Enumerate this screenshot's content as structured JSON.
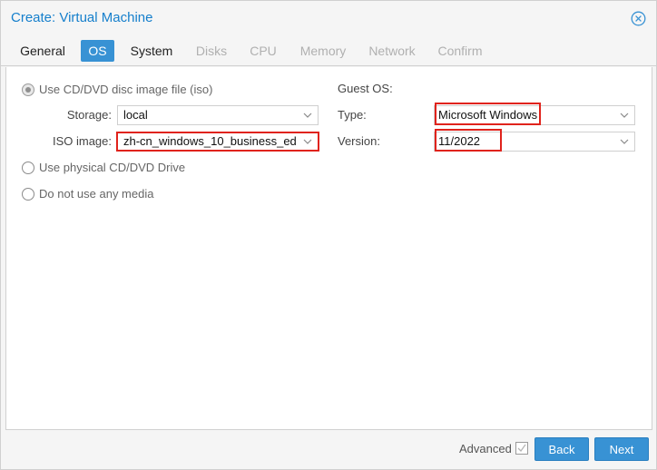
{
  "window": {
    "title": "Create: Virtual Machine",
    "close_icon": "close-circle-icon"
  },
  "tabs": [
    {
      "label": "General",
      "state": "enabled"
    },
    {
      "label": "OS",
      "state": "active"
    },
    {
      "label": "System",
      "state": "enabled"
    },
    {
      "label": "Disks",
      "state": "disabled"
    },
    {
      "label": "CPU",
      "state": "disabled"
    },
    {
      "label": "Memory",
      "state": "disabled"
    },
    {
      "label": "Network",
      "state": "disabled"
    },
    {
      "label": "Confirm",
      "state": "disabled"
    }
  ],
  "media": {
    "option_iso": "Use CD/DVD disc image file (iso)",
    "storage_label": "Storage:",
    "storage_value": "local",
    "iso_label": "ISO image:",
    "iso_value": "zh-cn_windows_10_business_ed",
    "option_physical": "Use physical CD/DVD Drive",
    "option_none": "Do not use any media",
    "selected": "iso"
  },
  "guest_os": {
    "heading": "Guest OS:",
    "type_label": "Type:",
    "type_value": "Microsoft Windows",
    "version_label": "Version:",
    "version_value": "11/2022"
  },
  "footer": {
    "advanced_label": "Advanced",
    "advanced_checked": false,
    "back_label": "Back",
    "next_label": "Next"
  },
  "colors": {
    "accent": "#3892d4",
    "title": "#157fcc",
    "highlight": "#e0231c"
  }
}
